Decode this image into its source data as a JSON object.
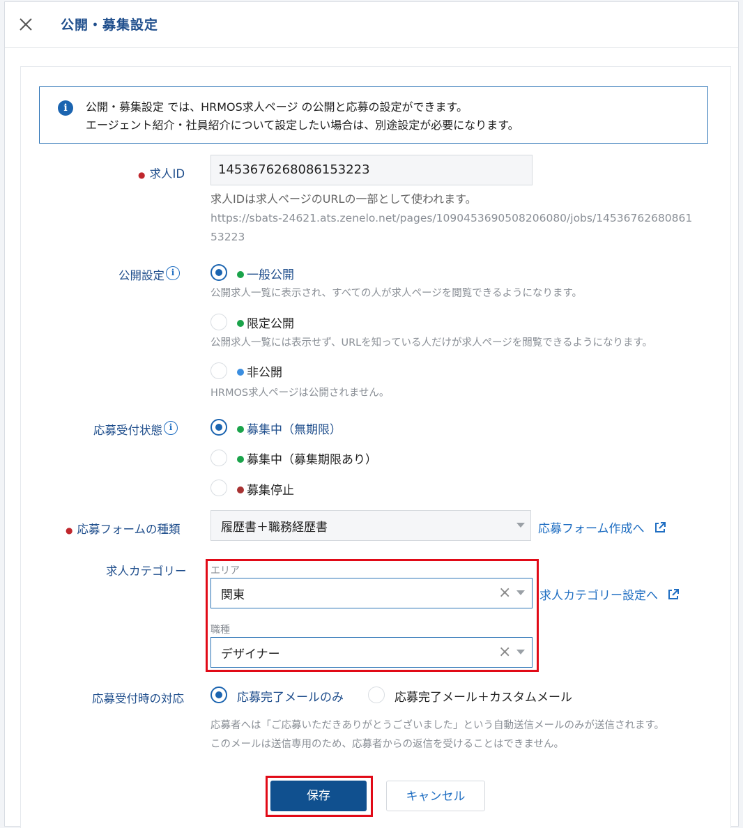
{
  "header": {
    "title": "公開・募集設定"
  },
  "info": {
    "line1": "公開・募集設定 では、HRMOS求人ページ の公開と応募の設定ができます。",
    "line2": "エージェント紹介・社員紹介について設定したい場合は、別途設定が必要になります。"
  },
  "job_id": {
    "label": "求人ID",
    "value": "1453676268086153223",
    "hint": "求人IDは求人ページのURLの一部として使われます。",
    "url": "https://sbats-24621.ats.zenelo.net/pages/1090453690508206080/jobs/1453676268086153223"
  },
  "visibility": {
    "label": "公開設定",
    "options": [
      {
        "label": "一般公開",
        "dot_color": "#1aa34a",
        "selected": true,
        "hint": "公開求人一覧に表示され、すべての人が求人ページを閲覧できるようになります。"
      },
      {
        "label": "限定公開",
        "dot_color": "#1aa34a",
        "selected": false,
        "hint": "公開求人一覧には表示せず、URLを知っている人だけが求人ページを閲覧できるようになります。"
      },
      {
        "label": "非公開",
        "dot_color": "#3b8ee0",
        "selected": false,
        "hint": "HRMOS求人ページは公開されません。"
      }
    ]
  },
  "status": {
    "label": "応募受付状態",
    "options": [
      {
        "label": "募集中（無期限）",
        "dot_color": "#1aa34a",
        "selected": true
      },
      {
        "label": "募集中（募集期限あり）",
        "dot_color": "#1aa34a",
        "selected": false
      },
      {
        "label": "募集停止",
        "dot_color": "#a83232",
        "selected": false
      }
    ]
  },
  "form_type": {
    "label": "応募フォームの種類",
    "value": "履歴書＋職務経歴書",
    "link": "応募フォーム作成へ"
  },
  "category": {
    "label": "求人カテゴリー",
    "area_label": "エリア",
    "area_value": "関東",
    "job_label": "職種",
    "job_value": "デザイナー",
    "link": "求人カテゴリー設定へ",
    "clear_symbol": "×"
  },
  "response": {
    "label": "応募受付時の対応",
    "option1": "応募完了メールのみ",
    "option2": "応募完了メール＋カスタムメール",
    "hint1": "応募者へは「ご応募いただきありがとうございました」という自動送信メールのみが送信されます。",
    "hint2": "このメールは送信専用のため、応募者からの返信を受けることはできません。"
  },
  "buttons": {
    "save": "保存",
    "cancel": "キャンセル"
  },
  "colors": {
    "accent": "#1f4e8c",
    "primary_button": "#10508f",
    "highlight": "#e10a17"
  }
}
